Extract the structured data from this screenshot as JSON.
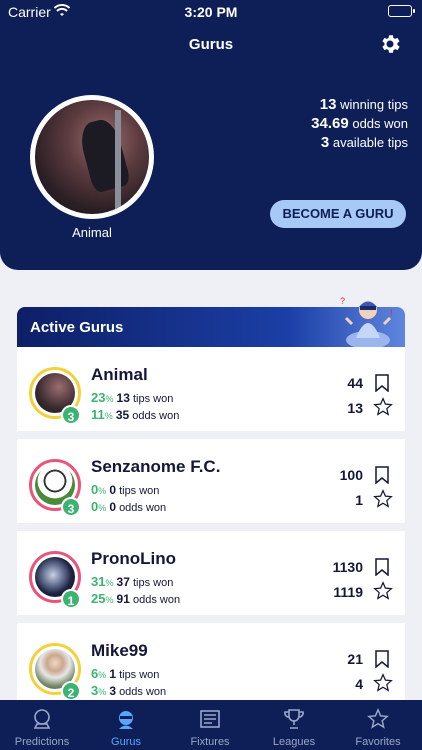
{
  "status_bar": {
    "carrier": "Carrier",
    "time": "3:20 PM"
  },
  "nav": {
    "title": "Gurus"
  },
  "profile": {
    "name": "Animal",
    "winning_tips": "13",
    "winning_tips_label": "winning tips",
    "odds_won": "34.69",
    "odds_won_label": "odds won",
    "available_tips": "3",
    "available_tips_label": "available tips",
    "become_guru_label": "BECOME A GURU"
  },
  "section": {
    "title": "Active Gurus"
  },
  "gurus": [
    {
      "name": "Animal",
      "rank": "3",
      "tips_pct": "23",
      "tips_won": "13",
      "tips_label": "tips won",
      "odds_pct": "11",
      "odds_won": "35",
      "odds_label": "odds won",
      "bookmarks": "44",
      "stars": "13",
      "ring": "#f2d23b"
    },
    {
      "name": "Senzanome F.C.",
      "rank": "3",
      "tips_pct": "0",
      "tips_won": "0",
      "tips_label": "tips won",
      "odds_pct": "0",
      "odds_won": "0",
      "odds_label": "odds won",
      "bookmarks": "100",
      "stars": "1",
      "ring": "#e8557a"
    },
    {
      "name": "PronoLino",
      "rank": "1",
      "tips_pct": "31",
      "tips_won": "37",
      "tips_label": "tips won",
      "odds_pct": "25",
      "odds_won": "91",
      "odds_label": "odds won",
      "bookmarks": "1130",
      "stars": "1119",
      "ring": "#e8557a"
    },
    {
      "name": "Mike99",
      "rank": "2",
      "tips_pct": "6",
      "tips_won": "1",
      "tips_label": "tips won",
      "odds_pct": "3",
      "odds_won": "3",
      "odds_label": "odds won",
      "bookmarks": "21",
      "stars": "4",
      "ring": "#f2d23b"
    }
  ],
  "pct_symbol": "%",
  "tabs": [
    {
      "label": "Predictions",
      "icon": "crystal-ball-icon"
    },
    {
      "label": "Gurus",
      "icon": "guru-icon"
    },
    {
      "label": "Fixtures",
      "icon": "newspaper-icon"
    },
    {
      "label": "Leagues",
      "icon": "trophy-icon"
    },
    {
      "label": "Favorites",
      "icon": "star-icon"
    }
  ],
  "colors": {
    "navy": "#0e1f57",
    "accent": "#58a6ff",
    "green": "#3cb371",
    "button": "#a6c9f5"
  }
}
